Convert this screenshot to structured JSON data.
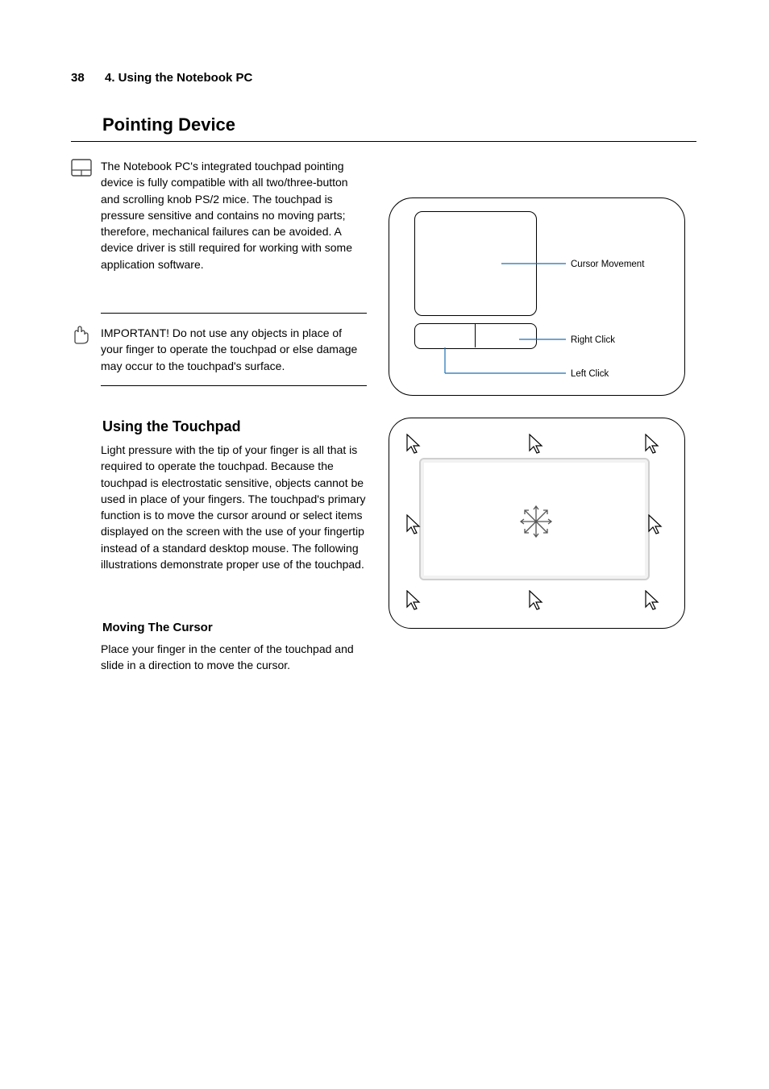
{
  "page_number": "38",
  "section_label": "4.    Using the Notebook PC",
  "heading": "Pointing Device",
  "intro": "The Notebook PC's integrated touchpad pointing device is fully compatible with all two/three-button and scrolling knob PS/2 mice. The touchpad is pressure sensitive and contains no moving parts; therefore, mechanical failures can be avoided. A device driver is still required for working with some application software.",
  "note": "IMPORTANT! Do not use any objects in place of your finger to operate the touchpad or else damage may occur to the touchpad's surface.",
  "using_heading": "Using the Touchpad",
  "para1": "Light pressure with the tip of your finger is all that is required to operate the touchpad. Because the touchpad is electrostatic sensitive, objects cannot be used in place of your fingers. The touchpad's primary function is to move the cursor around or select items displayed on the screen with the use of your fingertip instead of a standard desktop mouse. The following illustrations demonstrate proper use of the touchpad.",
  "moving_heading": "Moving The Cursor",
  "para2": "Place your finger in the center of the touchpad and slide in a direction to move the cursor.",
  "fig1_labels": {
    "cursor": "Cursor Movement",
    "right": "Right Click",
    "left": "Left Click"
  }
}
